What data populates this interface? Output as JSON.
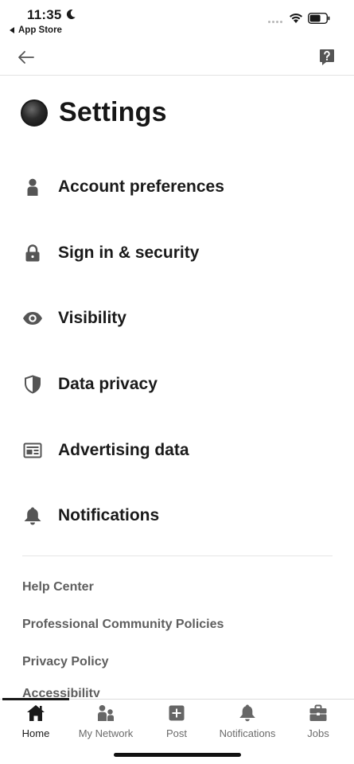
{
  "status_bar": {
    "time": "11:35",
    "back_app_label": "App Store"
  },
  "header": {
    "back_icon": "arrow-left-icon",
    "help_icon": "help-question-icon"
  },
  "page": {
    "title": "Settings"
  },
  "settings": [
    {
      "label": "Account preferences",
      "icon": "person-icon"
    },
    {
      "label": "Sign in & security",
      "icon": "lock-icon"
    },
    {
      "label": "Visibility",
      "icon": "eye-icon"
    },
    {
      "label": "Data privacy",
      "icon": "shield-icon"
    },
    {
      "label": "Advertising data",
      "icon": "newspaper-icon"
    },
    {
      "label": "Notifications",
      "icon": "bell-icon"
    }
  ],
  "footer_links": [
    "Help Center",
    "Professional Community Policies",
    "Privacy Policy",
    "Accessibility"
  ],
  "bottom_nav": [
    {
      "label": "Home",
      "icon": "home-icon",
      "active": true
    },
    {
      "label": "My Network",
      "icon": "network-icon",
      "active": false
    },
    {
      "label": "Post",
      "icon": "post-plus-icon",
      "active": false
    },
    {
      "label": "Notifications",
      "icon": "bell-icon",
      "active": false
    },
    {
      "label": "Jobs",
      "icon": "briefcase-icon",
      "active": false
    }
  ],
  "colors": {
    "text": "#1a1a1a",
    "muted": "#5e5e5e",
    "icon": "#555555",
    "divider": "#e6e6e6"
  }
}
